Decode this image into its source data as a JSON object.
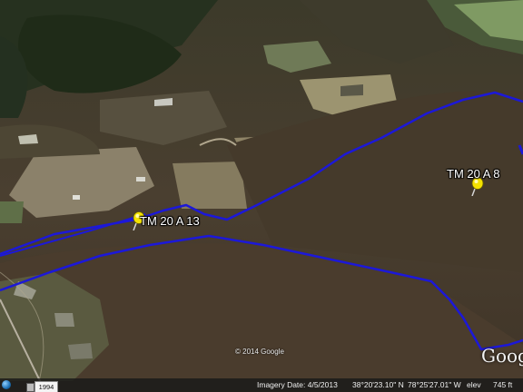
{
  "placemarks": [
    {
      "label": "TM 20 A 13",
      "pin_icon": "yellow-pushpin-icon",
      "pin_color": "#f4e200"
    },
    {
      "label": "TM 20 A 8",
      "pin_icon": "yellow-pushpin-icon",
      "pin_color": "#f4e200"
    }
  ],
  "parcel_line_color": "#1c18d8",
  "copyright": "© 2014 Google",
  "logo_text": "Google",
  "status_bar": {
    "historical_year": "1994",
    "imagery_date": "Imagery Date: 4/5/2013",
    "latitude": "38°20'23.10\" N",
    "longitude": "78°25'27.01\" W",
    "elev_label": "elev",
    "elev_value": "745 ft"
  }
}
